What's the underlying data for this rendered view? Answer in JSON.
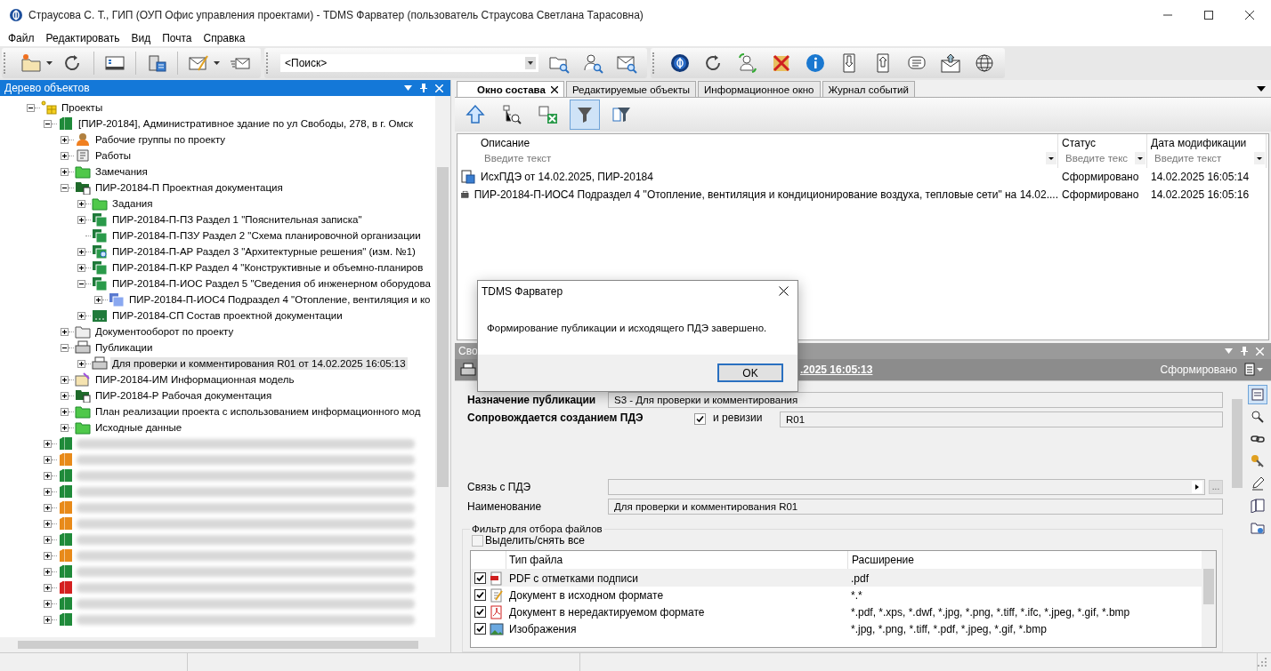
{
  "window": {
    "title": "Страусова С. Т., ГИП (ОУП Офис управления проектами) - TDMS Фарватер (пользователь Страусова Светлана Тарасовна)"
  },
  "menu": [
    "Файл",
    "Редактировать",
    "Вид",
    "Почта",
    "Справка"
  ],
  "search": {
    "value": "<Поиск>"
  },
  "tree_panel": {
    "title": "Дерево объектов"
  },
  "tree": [
    {
      "kind": "projects",
      "label": "Проекты",
      "expandable": true,
      "expanded": true,
      "selected": false,
      "children": [
        {
          "kind": "book",
          "label": "[ПИР-20184], Административное здание по ул Свободы, 278, в г. Омск",
          "color": "#1f8a3a",
          "expandable": true,
          "expanded": true,
          "selected": false,
          "children": [
            {
              "kind": "team",
              "label": "Рабочие группы по проекту",
              "expandable": true,
              "expanded": false,
              "selected": false
            },
            {
              "kind": "works",
              "label": "Работы",
              "expandable": true,
              "expanded": false,
              "selected": false
            },
            {
              "kind": "folder",
              "label": "Замечания",
              "expandable": true,
              "expanded": false,
              "selected": false
            },
            {
              "kind": "docfolder",
              "label": "ПИР-20184-П Проектная документация",
              "expandable": true,
              "expanded": true,
              "selected": false,
              "children": [
                {
                  "kind": "folder",
                  "label": "Задания",
                  "expandable": true,
                  "expanded": false,
                  "selected": false
                },
                {
                  "kind": "section",
                  "label": "ПИР-20184-П-ПЗ Раздел 1 \"Пояснительная записка\"",
                  "expandable": true,
                  "expanded": false,
                  "selected": false
                },
                {
                  "kind": "section",
                  "label": "ПИР-20184-П-ПЗУ Раздел 2 \"Схема планировочной организации",
                  "expandable": false,
                  "selected": false
                },
                {
                  "kind": "section-search",
                  "label": "ПИР-20184-П-АР Раздел 3 \"Архитектурные решения\" (изм. №1)",
                  "expandable": true,
                  "expanded": false,
                  "selected": false
                },
                {
                  "kind": "section",
                  "label": "ПИР-20184-П-КР Раздел 4 \"Конструктивные и объемно-планиров",
                  "expandable": true,
                  "expanded": false,
                  "selected": false
                },
                {
                  "kind": "section",
                  "label": "ПИР-20184-П-ИОС Раздел 5 \"Сведения об инженерном оборудова",
                  "expandable": true,
                  "expanded": true,
                  "selected": false,
                  "children": [
                    {
                      "kind": "subsection",
                      "label": "ПИР-20184-П-ИОС4 Подраздел 4 \"Отопление, вентиляция и ко",
                      "expandable": true,
                      "expanded": false,
                      "selected": false
                    }
                  ]
                },
                {
                  "kind": "list",
                  "label": "ПИР-20184-СП Состав проектной документации",
                  "expandable": true,
                  "expanded": false,
                  "selected": false
                }
              ]
            },
            {
              "kind": "folder-plain",
              "label": "Документооборот по проекту",
              "expandable": true,
              "expanded": false,
              "selected": false
            },
            {
              "kind": "printer",
              "label": "Публикации",
              "expandable": true,
              "expanded": true,
              "selected": false,
              "children": [
                {
                  "kind": "printer",
                  "label": "Для проверки и комментирования R01 от 14.02.2025 16:05:13",
                  "expandable": true,
                  "expanded": false,
                  "selected": true
                }
              ]
            },
            {
              "kind": "model",
              "label": "ПИР-20184-ИМ Информационная модель",
              "expandable": true,
              "expanded": false,
              "selected": false
            },
            {
              "kind": "docfolder",
              "label": "ПИР-20184-Р Рабочая документация",
              "expandable": true,
              "expanded": false,
              "selected": false
            },
            {
              "kind": "folder",
              "label": "План реализации проекта с использованием информационного мод",
              "expandable": true,
              "expanded": false,
              "selected": false
            },
            {
              "kind": "folder",
              "label": "Исходные данные",
              "expandable": true,
              "expanded": false,
              "selected": false
            }
          ]
        },
        {
          "kind": "blurred",
          "color": "#1f8a3a",
          "expandable": true,
          "expanded": false,
          "selected": false
        },
        {
          "kind": "blurred",
          "color": "#e88a1a",
          "expandable": true,
          "expanded": false,
          "selected": false
        },
        {
          "kind": "blurred",
          "color": "#1f8a3a",
          "expandable": true,
          "expanded": false,
          "selected": false
        },
        {
          "kind": "blurred",
          "color": "#1f8a3a",
          "expandable": true,
          "expanded": false,
          "selected": false
        },
        {
          "kind": "blurred",
          "color": "#e88a1a",
          "expandable": true,
          "expanded": false,
          "selected": false
        },
        {
          "kind": "blurred",
          "color": "#e88a1a",
          "expandable": true,
          "expanded": false,
          "selected": false
        },
        {
          "kind": "blurred",
          "color": "#1f8a3a",
          "expandable": true,
          "expanded": false,
          "selected": false
        },
        {
          "kind": "blurred",
          "color": "#e88a1a",
          "expandable": true,
          "expanded": false,
          "selected": false
        },
        {
          "kind": "blurred",
          "color": "#1f8a3a",
          "expandable": true,
          "expanded": false,
          "selected": false
        },
        {
          "kind": "blurred",
          "color": "#d42020",
          "expandable": true,
          "expanded": false,
          "selected": false
        },
        {
          "kind": "blurred",
          "color": "#1f8a3a",
          "expandable": true,
          "expanded": false,
          "selected": false
        },
        {
          "kind": "blurred",
          "color": "#1f8a3a",
          "expandable": true,
          "expanded": false,
          "selected": false
        }
      ]
    }
  ],
  "tabs": [
    {
      "label": "Окно состава",
      "selected": true,
      "closable": true
    },
    {
      "label": "Редактируемые объекты",
      "selected": false,
      "closable": false
    },
    {
      "label": "Информационное окно",
      "selected": false,
      "closable": false
    },
    {
      "label": "Журнал событий",
      "selected": false,
      "closable": false
    }
  ],
  "composition_tools": [
    {
      "selected": false
    },
    {
      "selected": false
    },
    {
      "selected": false
    },
    {
      "selected": true
    },
    {
      "selected": false
    }
  ],
  "table": {
    "columns": [
      {
        "label": "Описание",
        "placeholder": "Введите текст"
      },
      {
        "label": "Статус",
        "placeholder": "Введите текс"
      },
      {
        "label": "Дата модификации",
        "placeholder": "Введите текст"
      }
    ],
    "rows": [
      {
        "kind": "pde",
        "description": "ИсхПДЭ от 14.02.2025, ПИР-20184",
        "status": "Сформировано",
        "date": "14.02.2025 16:05:14"
      },
      {
        "kind": "section",
        "description": "ПИР-20184-П-ИОС4 Подраздел 4 \"Отопление, вентиляция и кондиционирование воздуха, тепловые сети\" на 14.02....",
        "status": "Сформировано",
        "date": "14.02.2025 16:05:16"
      }
    ]
  },
  "dialog": {
    "title": "TDMS Фарватер",
    "message": "Формирование публикации и исходящего ПДЭ завершено.",
    "button": "OK"
  },
  "properties": {
    "panel_title": "Сво",
    "header_link": ".2025 16:05:13",
    "status": "Сформировано",
    "purpose": {
      "label": "Назначение публикации",
      "value": "S3 - Для проверки и комментирования"
    },
    "pde": {
      "label": "Сопровождается созданием ПДЭ",
      "checked": true,
      "revision_label": "и ревизии",
      "revision": "R01"
    },
    "link": {
      "label": "Связь с ПДЭ",
      "button": "..."
    },
    "name": {
      "label": "Наименование",
      "value": "Для проверки и комментирования R01"
    },
    "filter": {
      "title": "Фильтр для отбора файлов",
      "select_all": {
        "label": "Выделить/снять все",
        "checked": false
      },
      "columns": [
        "Тип файла",
        "Расширение"
      ],
      "rows": [
        {
          "checked": true,
          "kind": "pdf-stamp",
          "type": "PDF с отметками подписи",
          "ext": ".pdf"
        },
        {
          "checked": true,
          "kind": "edit-doc",
          "type": "Документ в исходном формате",
          "ext": "*.*"
        },
        {
          "checked": true,
          "kind": "pdf",
          "type": "Документ в нередактируемом формате",
          "ext": "*.pdf, *.xps, *.dwf, *.jpg, *.png, *.tiff, *.ifc,  *.jpeg, *.gif, *.bmp"
        },
        {
          "checked": true,
          "kind": "image",
          "type": "Изображения",
          "ext": "*.jpg, *.png, *.tiff, *.pdf, *.jpeg, *.gif, *.bmp"
        }
      ]
    }
  },
  "side_tools": [
    {
      "selected": true
    },
    {
      "selected": false
    },
    {
      "selected": false
    },
    {
      "selected": false
    },
    {
      "selected": false
    },
    {
      "selected": false
    },
    {
      "selected": false
    }
  ]
}
